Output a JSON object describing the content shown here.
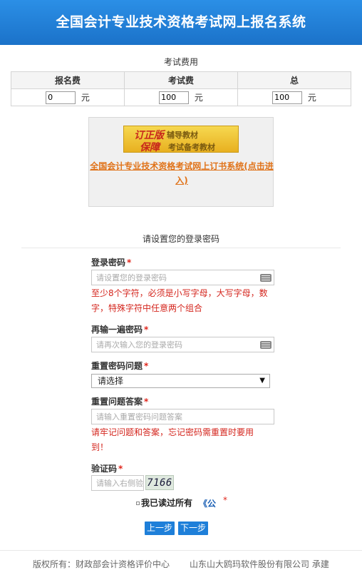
{
  "header": {
    "title": "全国会计专业技术资格考试网上报名系统"
  },
  "fees": {
    "title": "考试费用",
    "columns": [
      "报名费",
      "考试费",
      "总"
    ],
    "values": [
      "0",
      "100",
      "100"
    ],
    "unit": "元"
  },
  "ad": {
    "banner_line1": "订正版",
    "banner_line1_small": "辅导教材",
    "banner_line2": "保障",
    "banner_line2_small": "考试备考教材",
    "link_text": "全国会计专业技术资格考试网上订书系统(点击进入)"
  },
  "form": {
    "section_title": "请设置您的登录密码",
    "required_mark": "*",
    "password": {
      "label": "登录密码",
      "placeholder": "请设置您的登录密码",
      "hint": "至少8个字符，必须是小写字母，大写字母，数字，特殊字符中任意两个组合"
    },
    "password_confirm": {
      "label": "再输一遍密码",
      "placeholder": "请再次输入您的登录密码"
    },
    "question": {
      "label": "重置密码问题",
      "selected": "请选择",
      "arrow": "▼"
    },
    "answer": {
      "label": "重置问题答案",
      "placeholder": "请输入重置密码问题答案",
      "hint": "请牢记问题和答案，忘记密码需重置时要用到！"
    },
    "captcha": {
      "label": "验证码",
      "placeholder": "请输入右侧验证码",
      "code": "7166"
    },
    "agree": {
      "text": "我已读过所有",
      "link": "《公"
    },
    "buttons": {
      "prev": "上一步",
      "next": "下一步"
    }
  },
  "footer": {
    "left": "版权所有：财政部会计资格评价中心",
    "right": "山东山大鸥玛软件股份有限公司 承建"
  }
}
